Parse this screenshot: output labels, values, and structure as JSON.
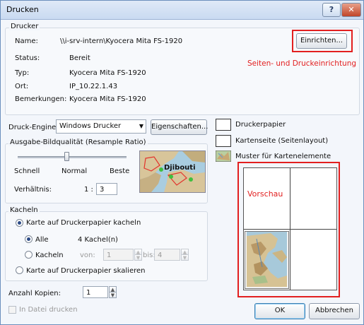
{
  "window": {
    "title": "Drucken",
    "help_label": "?",
    "close_label": "✕"
  },
  "drucker": {
    "group_label": "Drucker",
    "name_label": "Name:",
    "name_value": "\\\\i-srv-intern\\Kyocera Mita FS-1920",
    "status_label": "Status:",
    "status_value": "Bereit",
    "typ_label": "Typ:",
    "typ_value": "Kyocera Mita FS-1920",
    "ort_label": "Ort:",
    "ort_value": "IP_10.22.1.43",
    "bemerkungen_label": "Bemerkungen:",
    "bemerkungen_value": "Kyocera Mita FS-1920",
    "einrichten_label": "Einrichten...",
    "annotation": "Seiten- und Druckeinrichtung"
  },
  "engine": {
    "label": "Druck-Engine:",
    "value": "Windows Drucker",
    "eigenschaften_label": "Eigenschaften..."
  },
  "quality": {
    "group_label": "Ausgabe-Bildqualität (Resample Ratio)",
    "ticks": [
      "Schnell",
      "Normal",
      "Beste"
    ],
    "slider_fraction": 0.45,
    "ratio_label": "Verhältnis:",
    "ratio_prefix": "1 :",
    "ratio_value": "3",
    "map_label": "Djibouti"
  },
  "kacheln": {
    "group_label": "Kacheln",
    "opt_tile": "Karte auf Druckerpapier kacheln",
    "opt_all": "Alle",
    "all_count": "4 Kachel(n)",
    "opt_tiles": "Kacheln",
    "von_label": "von:",
    "von_value": "1",
    "bis_label": "bis:",
    "bis_value": "4",
    "opt_scale": "Karte auf Druckerpapier skalieren"
  },
  "copies": {
    "label": "Anzahl Kopien:",
    "value": "1"
  },
  "print_to_file": "In Datei drucken",
  "legend": {
    "paper": "Druckerpapier",
    "page": "Kartenseite (Seitenlayout)",
    "pattern": "Muster für Kartenelemente"
  },
  "preview": {
    "label": "Vorschau"
  },
  "buttons": {
    "ok": "OK",
    "cancel": "Abbrechen"
  },
  "colors": {
    "accent_red": "#e21f1f",
    "title_blue": "#c9daf1"
  }
}
